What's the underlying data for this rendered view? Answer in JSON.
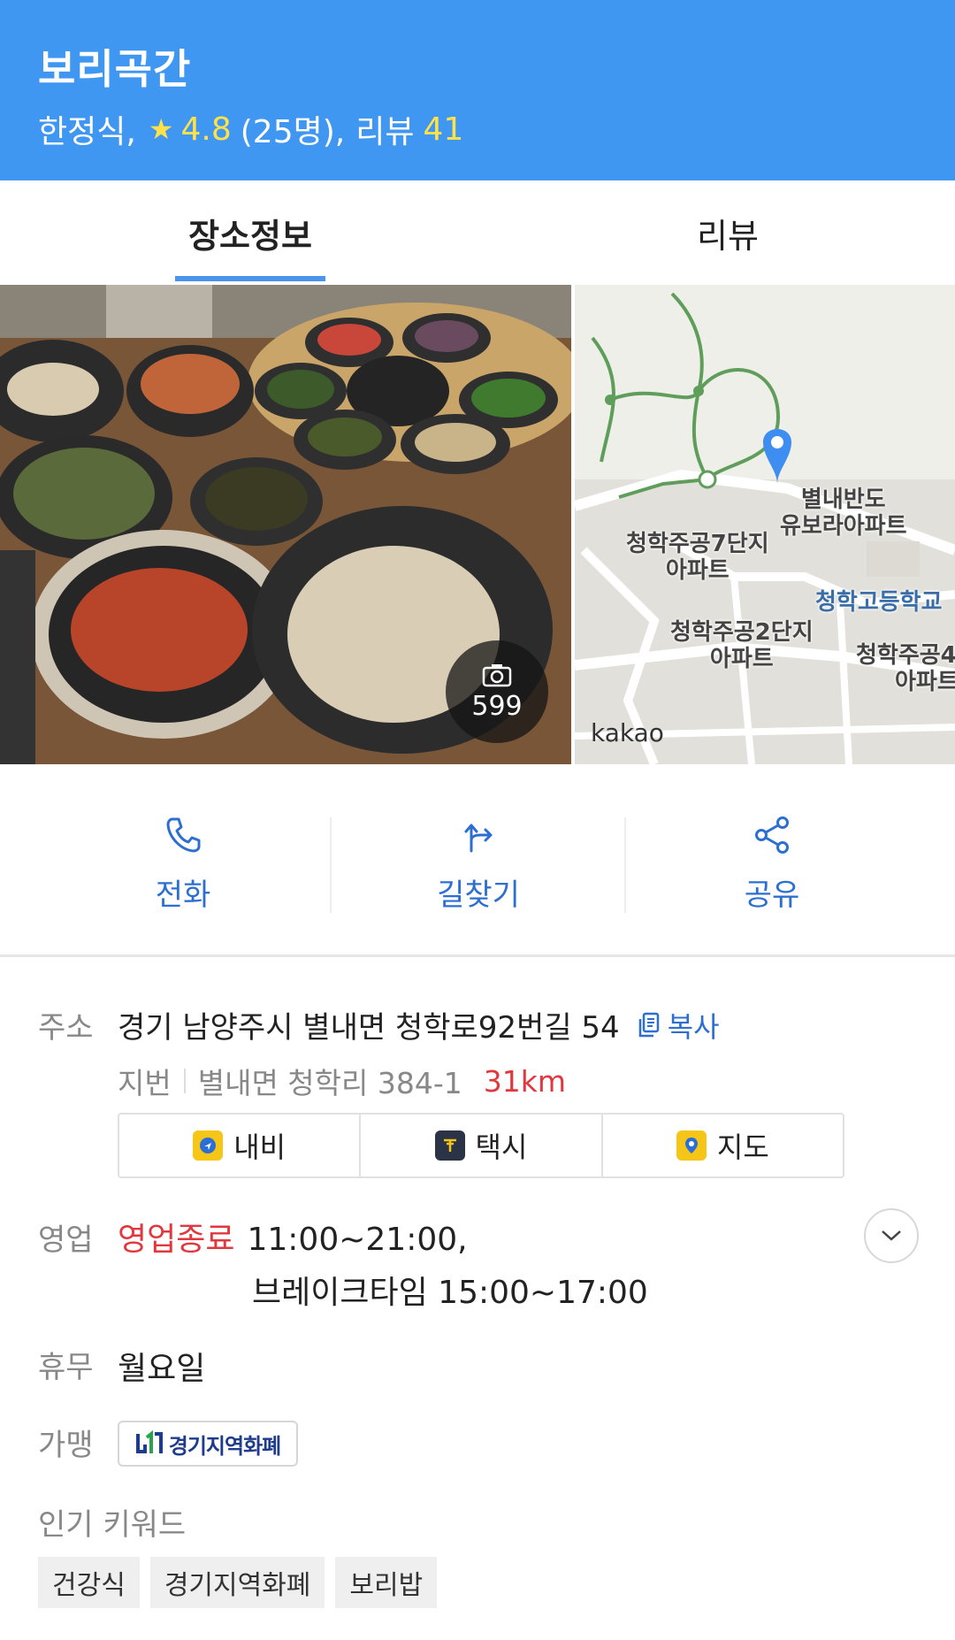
{
  "header": {
    "title": "보리곡간",
    "category": "한정식,",
    "rating": "4.8",
    "rating_count": "(25명),",
    "review_label": "리뷰",
    "review_count": "41"
  },
  "tabs": [
    {
      "label": "장소정보",
      "active": true
    },
    {
      "label": "리뷰",
      "active": false
    }
  ],
  "media": {
    "photo_count": "599",
    "map_labels": [
      "별내반도",
      "유보라아파트",
      "청학주공7단지",
      "아파트",
      "청학고등학교",
      "청학주공2단지",
      "아파트",
      "청학주공4",
      "아파트"
    ],
    "map_logo": "kakao"
  },
  "actions": [
    {
      "label": "전화",
      "icon": "phone-icon"
    },
    {
      "label": "길찾기",
      "icon": "directions-icon"
    },
    {
      "label": "공유",
      "icon": "share-icon"
    }
  ],
  "info": {
    "address_label": "주소",
    "address": "경기 남양주시 별내면 청학로92번길 54",
    "copy_label": "복사",
    "jibun_label": "지번",
    "jibun": "별내면 청학리 384-1",
    "distance": "31km",
    "nav_buttons": [
      {
        "label": "내비",
        "icon": "navi-icon",
        "color": "#f5c518"
      },
      {
        "label": "택시",
        "icon": "taxi-icon",
        "color": "#2b3447"
      },
      {
        "label": "지도",
        "icon": "map-pin-icon",
        "color": "#f5c518"
      }
    ],
    "hours_label": "영업",
    "hours_status": "영업종료",
    "hours": "11:00~21:00,",
    "break_time": "브레이크타임 15:00~17:00",
    "holiday_label": "휴무",
    "holiday": "월요일",
    "affiliate_label": "가맹",
    "affiliate": "경기지역화폐",
    "keywords_label": "인기 키워드",
    "keywords": [
      "건강식",
      "경기지역화폐",
      "보리밥"
    ]
  },
  "colors": {
    "header_bg": "#4097f1",
    "accent_blue": "#2d6fd1",
    "accent_red": "#e0383e",
    "rating_yellow": "#ffe24a"
  }
}
